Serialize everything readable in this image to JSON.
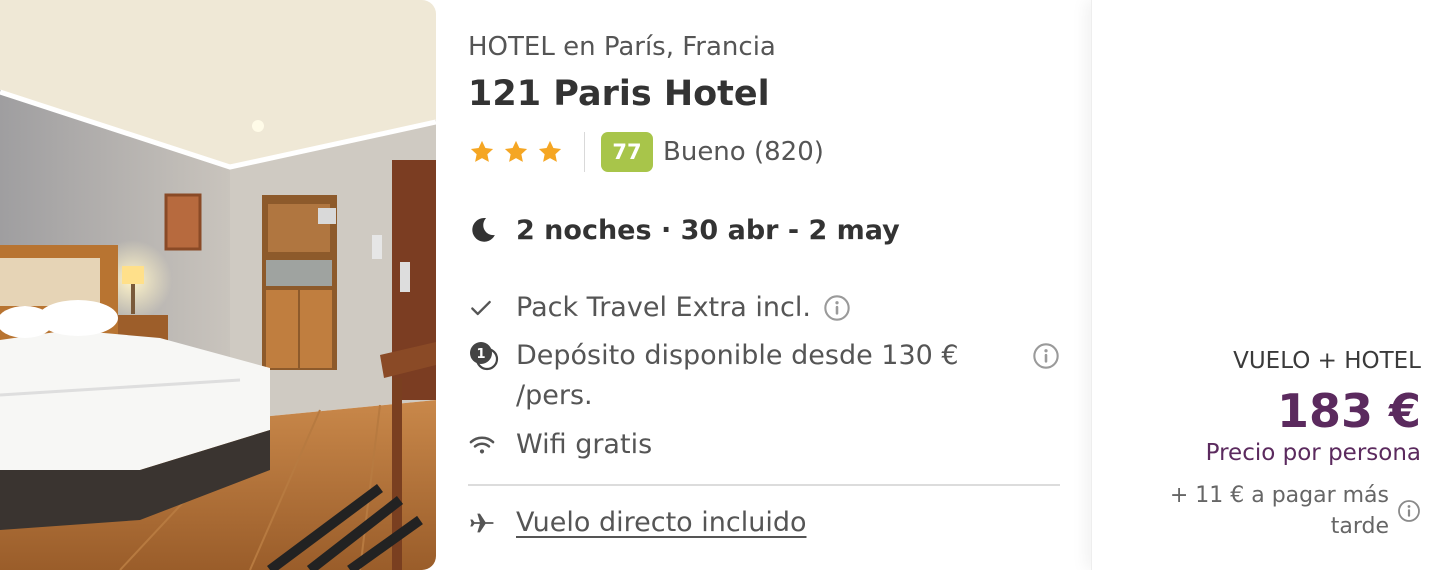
{
  "hotel": {
    "location": "HOTEL en París, Francia",
    "name": "121 Paris Hotel",
    "stars": 3,
    "score": "77",
    "score_text": "Bueno (820)",
    "dates": "2 noches · 30 abr - 2 may"
  },
  "features": {
    "pack": "Pack Travel Extra incl.",
    "deposit": "Depósito disponible desde 130 € /pers.",
    "wifi": "Wifi gratis",
    "flight": "Vuelo directo incluido"
  },
  "price": {
    "label": "VUELO + HOTEL",
    "amount": "183 €",
    "per_person": "Precio por persona",
    "extra": "+ 11 € a pagar más tarde"
  },
  "colors": {
    "star": "#f5a623",
    "score_badge": "#a8c54a",
    "price": "#5b2a5e"
  },
  "icons": [
    "star-icon",
    "moon-icon",
    "check-icon",
    "deposit-icon",
    "info-icon",
    "wifi-icon",
    "plane-icon"
  ]
}
